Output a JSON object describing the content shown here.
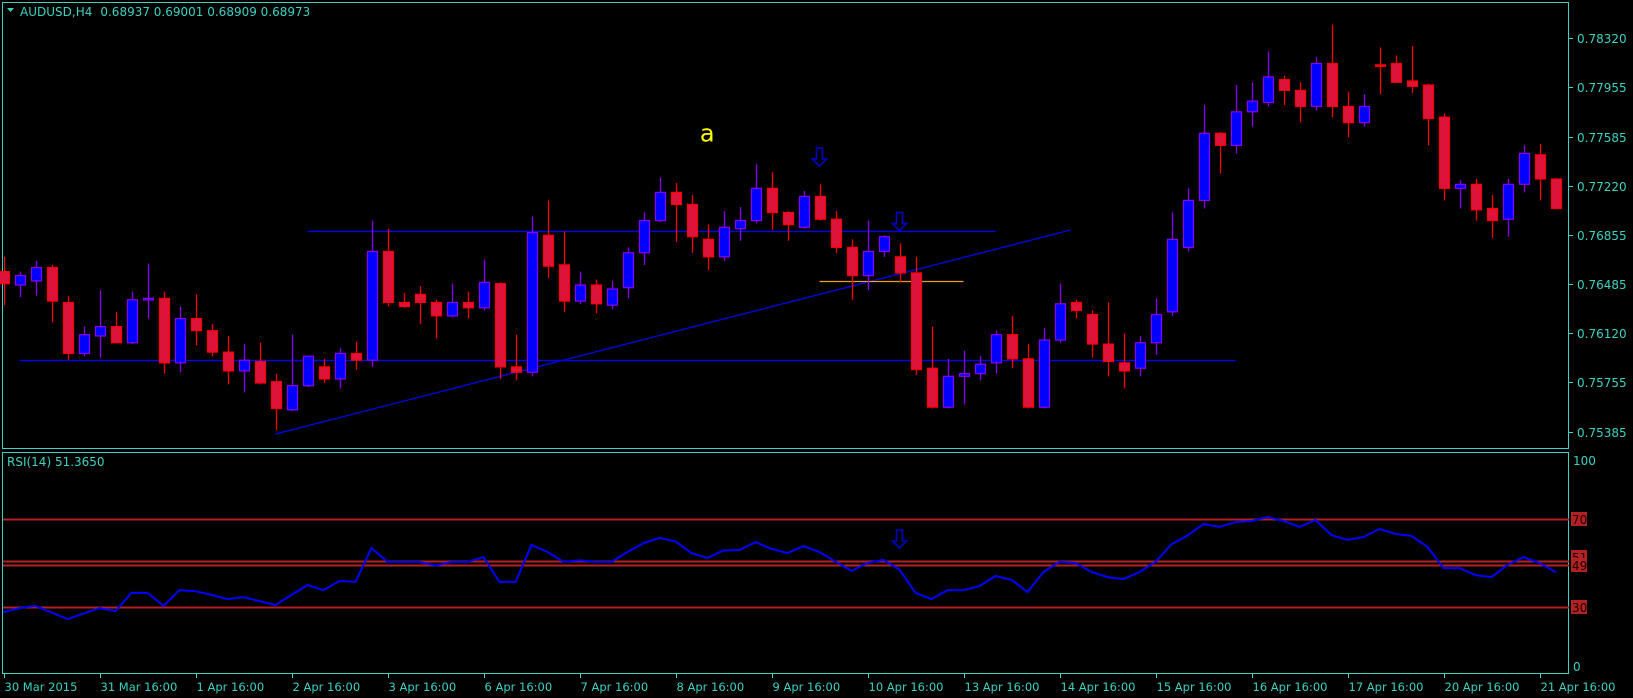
{
  "header": {
    "symbol": "AUDUSD,H4",
    "quote": "0.68937 0.69001 0.68909 0.68973"
  },
  "rsi_panel": {
    "label": "RSI(14) 51.3650",
    "scale_top": "100",
    "scale_bottom": "0"
  },
  "colors": {
    "background": "#000000",
    "axis": "#3cd2c2",
    "bull_body": "#0000ff",
    "bull_border": "#8a00ff",
    "bear_body": "#dc143c",
    "bear_border": "#ff0000",
    "rsi_line": "#0000ff",
    "rsi_level": "#b22222",
    "hline": "#0000ff",
    "orange_line": "#f0a020",
    "annotation": "#ffff00"
  },
  "chart_data": {
    "type": "candlestick",
    "title": "AUDUSD,H4",
    "ylim": [
      0.75385,
      0.7832
    ],
    "price_ticks": [
      "0.78320",
      "0.77955",
      "0.77585",
      "0.77220",
      "0.76855",
      "0.76485",
      "0.76120",
      "0.75755",
      "0.75385"
    ],
    "date_labels": [
      "30 Mar 2015",
      "31 Mar 16:00",
      "1 Apr 16:00",
      "2 Apr 16:00",
      "3 Apr 16:00",
      "6 Apr 16:00",
      "7 Apr 16:00",
      "8 Apr 16:00",
      "9 Apr 16:00",
      "10 Apr 16:00",
      "13 Apr 16:00",
      "14 Apr 16:00",
      "15 Apr 16:00",
      "16 Apr 16:00",
      "17 Apr 16:00",
      "20 Apr 16:00",
      "21 Apr 16:00"
    ],
    "bars_per_date_label": 6,
    "candles_ohlc": [
      [
        0.7658,
        0.7669,
        0.7633,
        0.7649
      ],
      [
        0.7648,
        0.7658,
        0.7639,
        0.7655
      ],
      [
        0.7651,
        0.7666,
        0.764,
        0.7661
      ],
      [
        0.7661,
        0.7663,
        0.762,
        0.7636
      ],
      [
        0.7635,
        0.764,
        0.7592,
        0.7597
      ],
      [
        0.7597,
        0.7617,
        0.7595,
        0.7611
      ],
      [
        0.761,
        0.7644,
        0.7594,
        0.7617
      ],
      [
        0.7617,
        0.7628,
        0.7605,
        0.7605
      ],
      [
        0.7605,
        0.7643,
        0.7604,
        0.7637
      ],
      [
        0.7637,
        0.7664,
        0.7623,
        0.7638
      ],
      [
        0.7638,
        0.7643,
        0.7582,
        0.759
      ],
      [
        0.759,
        0.7632,
        0.7583,
        0.7623
      ],
      [
        0.7623,
        0.7641,
        0.7603,
        0.7614
      ],
      [
        0.7614,
        0.7619,
        0.7595,
        0.7598
      ],
      [
        0.7598,
        0.761,
        0.7574,
        0.7584
      ],
      [
        0.7584,
        0.7604,
        0.7568,
        0.7592
      ],
      [
        0.7591,
        0.7605,
        0.7574,
        0.7575
      ],
      [
        0.7576,
        0.7582,
        0.754,
        0.7556
      ],
      [
        0.7555,
        0.7611,
        0.7554,
        0.7573
      ],
      [
        0.7573,
        0.7595,
        0.7572,
        0.7595
      ],
      [
        0.7587,
        0.7593,
        0.7575,
        0.7578
      ],
      [
        0.7578,
        0.7601,
        0.7571,
        0.7597
      ],
      [
        0.7597,
        0.7606,
        0.7585,
        0.7592
      ],
      [
        0.7592,
        0.7696,
        0.7587,
        0.7673
      ],
      [
        0.7673,
        0.769,
        0.7632,
        0.7635
      ],
      [
        0.7635,
        0.7642,
        0.7631,
        0.7632
      ],
      [
        0.7641,
        0.7647,
        0.7619,
        0.7635
      ],
      [
        0.7635,
        0.7637,
        0.7608,
        0.7625
      ],
      [
        0.7625,
        0.7649,
        0.7624,
        0.7635
      ],
      [
        0.7635,
        0.7643,
        0.7623,
        0.7631
      ],
      [
        0.7631,
        0.7667,
        0.7629,
        0.765
      ],
      [
        0.7649,
        0.765,
        0.7578,
        0.7587
      ],
      [
        0.7587,
        0.7611,
        0.7577,
        0.7583
      ],
      [
        0.7583,
        0.7699,
        0.758,
        0.7687
      ],
      [
        0.7685,
        0.7711,
        0.7653,
        0.7662
      ],
      [
        0.7663,
        0.7688,
        0.7628,
        0.7636
      ],
      [
        0.7636,
        0.7658,
        0.7634,
        0.7648
      ],
      [
        0.7648,
        0.7652,
        0.7627,
        0.7634
      ],
      [
        0.7633,
        0.7651,
        0.763,
        0.7645
      ],
      [
        0.7646,
        0.7676,
        0.7638,
        0.7672
      ],
      [
        0.7672,
        0.7702,
        0.7663,
        0.7696
      ],
      [
        0.7696,
        0.7728,
        0.7695,
        0.7717
      ],
      [
        0.7717,
        0.7724,
        0.768,
        0.7708
      ],
      [
        0.7708,
        0.7715,
        0.7672,
        0.7684
      ],
      [
        0.7682,
        0.7693,
        0.7659,
        0.7669
      ],
      [
        0.7669,
        0.7703,
        0.7666,
        0.7691
      ],
      [
        0.769,
        0.7706,
        0.7681,
        0.7696
      ],
      [
        0.7696,
        0.7738,
        0.7694,
        0.772
      ],
      [
        0.772,
        0.7732,
        0.7689,
        0.7702
      ],
      [
        0.7702,
        0.7703,
        0.7681,
        0.7693
      ],
      [
        0.7691,
        0.7718,
        0.769,
        0.7714
      ],
      [
        0.7714,
        0.7723,
        0.7696,
        0.7697
      ],
      [
        0.7697,
        0.7703,
        0.7672,
        0.7676
      ],
      [
        0.7676,
        0.7682,
        0.7637,
        0.7655
      ],
      [
        0.7655,
        0.7696,
        0.7644,
        0.7673
      ],
      [
        0.7673,
        0.7685,
        0.7669,
        0.7684
      ],
      [
        0.7669,
        0.7679,
        0.765,
        0.7657
      ],
      [
        0.7657,
        0.7669,
        0.7581,
        0.7585
      ],
      [
        0.7586,
        0.7617,
        0.7556,
        0.7557
      ],
      [
        0.7557,
        0.7593,
        0.7556,
        0.758
      ],
      [
        0.758,
        0.7599,
        0.7559,
        0.7582
      ],
      [
        0.7582,
        0.7595,
        0.7577,
        0.7589
      ],
      [
        0.759,
        0.7614,
        0.7582,
        0.7611
      ],
      [
        0.7611,
        0.7625,
        0.7586,
        0.7593
      ],
      [
        0.7593,
        0.7604,
        0.7556,
        0.7557
      ],
      [
        0.7557,
        0.7616,
        0.7556,
        0.7607
      ],
      [
        0.7607,
        0.7649,
        0.7605,
        0.7634
      ],
      [
        0.7635,
        0.7637,
        0.7623,
        0.7629
      ],
      [
        0.7626,
        0.7629,
        0.7594,
        0.7604
      ],
      [
        0.7604,
        0.7635,
        0.758,
        0.7591
      ],
      [
        0.759,
        0.7612,
        0.7571,
        0.7584
      ],
      [
        0.7586,
        0.761,
        0.758,
        0.7605
      ],
      [
        0.7605,
        0.7638,
        0.7596,
        0.7626
      ],
      [
        0.7628,
        0.7702,
        0.7625,
        0.7682
      ],
      [
        0.7676,
        0.772,
        0.7673,
        0.7711
      ],
      [
        0.7711,
        0.7782,
        0.7705,
        0.7761
      ],
      [
        0.7761,
        0.7762,
        0.7731,
        0.7752
      ],
      [
        0.7752,
        0.7797,
        0.7746,
        0.7777
      ],
      [
        0.7777,
        0.7799,
        0.7766,
        0.7785
      ],
      [
        0.7784,
        0.7822,
        0.7781,
        0.7803
      ],
      [
        0.7801,
        0.7804,
        0.7782,
        0.7793
      ],
      [
        0.7793,
        0.7799,
        0.7769,
        0.7781
      ],
      [
        0.7781,
        0.7818,
        0.7778,
        0.7813
      ],
      [
        0.7813,
        0.7842,
        0.7773,
        0.7781
      ],
      [
        0.7781,
        0.7792,
        0.7758,
        0.7769
      ],
      [
        0.7769,
        0.779,
        0.7766,
        0.7781
      ],
      [
        0.7812,
        0.7825,
        0.779,
        0.7812
      ],
      [
        0.7813,
        0.7819,
        0.7799,
        0.7799
      ],
      [
        0.78,
        0.7826,
        0.7791,
        0.7796
      ],
      [
        0.7797,
        0.7798,
        0.7752,
        0.7772
      ],
      [
        0.7773,
        0.7776,
        0.7711,
        0.772
      ],
      [
        0.772,
        0.7726,
        0.7705,
        0.7723
      ],
      [
        0.7723,
        0.7727,
        0.7696,
        0.7704
      ],
      [
        0.7705,
        0.7715,
        0.7683,
        0.7696
      ],
      [
        0.7697,
        0.7727,
        0.7684,
        0.7723
      ],
      [
        0.7723,
        0.7752,
        0.7717,
        0.7746
      ],
      [
        0.7745,
        0.7753,
        0.7711,
        0.7727
      ],
      [
        0.7727,
        0.7727,
        0.7705,
        0.7705
      ]
    ],
    "rsi": {
      "period": 14,
      "ylim": [
        0,
        100
      ],
      "levels": [
        70,
        51,
        49,
        30
      ],
      "level_labels": [
        "70",
        "51",
        "49",
        "30"
      ],
      "values": [
        27.7,
        29.5,
        30.5,
        27.5,
        24.5,
        27,
        29.5,
        28.2,
        36.4,
        36.4,
        30.5,
        37.7,
        37.2,
        35.5,
        33.6,
        34.5,
        32.7,
        30.9,
        35.5,
        40,
        37.7,
        41.8,
        41.4,
        56.8,
        50.5,
        50.5,
        50.5,
        48.8,
        50.5,
        50.5,
        52.7,
        41.4,
        41.4,
        58.2,
        55,
        50.5,
        51.2,
        50.5,
        50.5,
        55,
        59,
        61.4,
        59.8,
        54.5,
        52.3,
        55.7,
        55.9,
        59.5,
        56.4,
        54.5,
        57.7,
        55,
        50.6,
        46.4,
        50,
        51.4,
        47,
        36.4,
        33.6,
        37.7,
        37.7,
        39.5,
        44.1,
        42.3,
        36.8,
        45.9,
        50.5,
        50,
        45.9,
        43.6,
        42.7,
        45.9,
        50.5,
        58.5,
        62.5,
        67.7,
        66.4,
        68.6,
        69.1,
        70.9,
        69.1,
        66.4,
        69.5,
        62.7,
        60.5,
        61.8,
        65.5,
        63.2,
        62.3,
        57.3,
        47.7,
        47.7,
        44.5,
        43.6,
        49.1,
        52.7,
        50,
        45.9
      ]
    },
    "objects": {
      "horizontal_lines": [
        {
          "price": 0.7592,
          "from_bar": 1,
          "to_bar": 77
        },
        {
          "price": 0.7688,
          "from_bar": 19,
          "to_bar": 62
        }
      ],
      "trendline": {
        "from_bar": 17,
        "from_price": 0.7537,
        "to_bar": 66.7,
        "to_price": 0.7689
      },
      "orange_line": {
        "price": 0.7651,
        "from_bar": 51,
        "to_bar": 60
      },
      "down_arrows_price": [
        {
          "bar": 51,
          "price": 0.775
        },
        {
          "bar": 56,
          "price": 0.7702
        }
      ],
      "down_arrow_rsi": {
        "bar": 56,
        "value": 65
      },
      "text_label": {
        "text": "a",
        "bar": 43.9,
        "price": 0.7766
      }
    }
  }
}
